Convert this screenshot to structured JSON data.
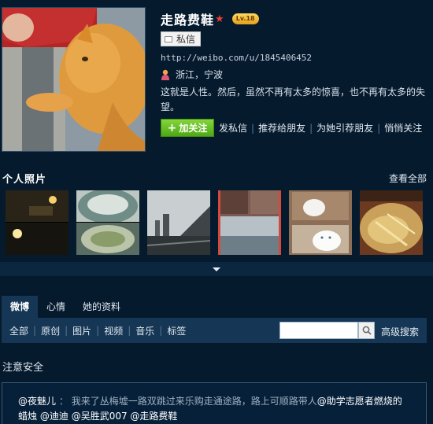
{
  "profile": {
    "name": "走路费鞋",
    "level_badge": "Lv.18",
    "message_button": "私信",
    "url": "http://weibo.com/u/1845406452",
    "location": "浙江，宁波",
    "bio": "这就是人性。然后，虽然不再有太多的惊喜，也不再有太多的失望。",
    "actions": {
      "follow": "加关注",
      "send_message": "发私信",
      "recommend": "推荐给朋友",
      "recommend_to_her": "为她引荐朋友",
      "quiet_follow": "悄悄关注"
    }
  },
  "photos": {
    "title": "个人照片",
    "see_all": "查看全部",
    "items": [
      "night-street",
      "plate-food",
      "city-skyline",
      "lake-view",
      "white-cats",
      "dish-closeup"
    ]
  },
  "tabs": [
    "微博",
    "心情",
    "她的资料"
  ],
  "active_tab": "微博",
  "filters": [
    "全部",
    "原创",
    "图片",
    "视频",
    "音乐",
    "标签"
  ],
  "search": {
    "placeholder": "",
    "advanced": "高级搜索"
  },
  "feed": {
    "section_title": "注意安全",
    "post": {
      "author": "@夜魅儿",
      "separator": "：",
      "text": "我来了丛梅墟一路双跳过来乐购走通途路，路上可顺路带人",
      "mention1": "@助学志愿者燃烧的蜡烛",
      "mention2": "@迪迪",
      "mention3": "@吴胜武007",
      "mention4": "@走路费鞋"
    }
  },
  "colors": {
    "background": "#061a2e",
    "panel": "#153654",
    "follow_green": "#5fbf1f",
    "star_red": "#e8402c"
  }
}
